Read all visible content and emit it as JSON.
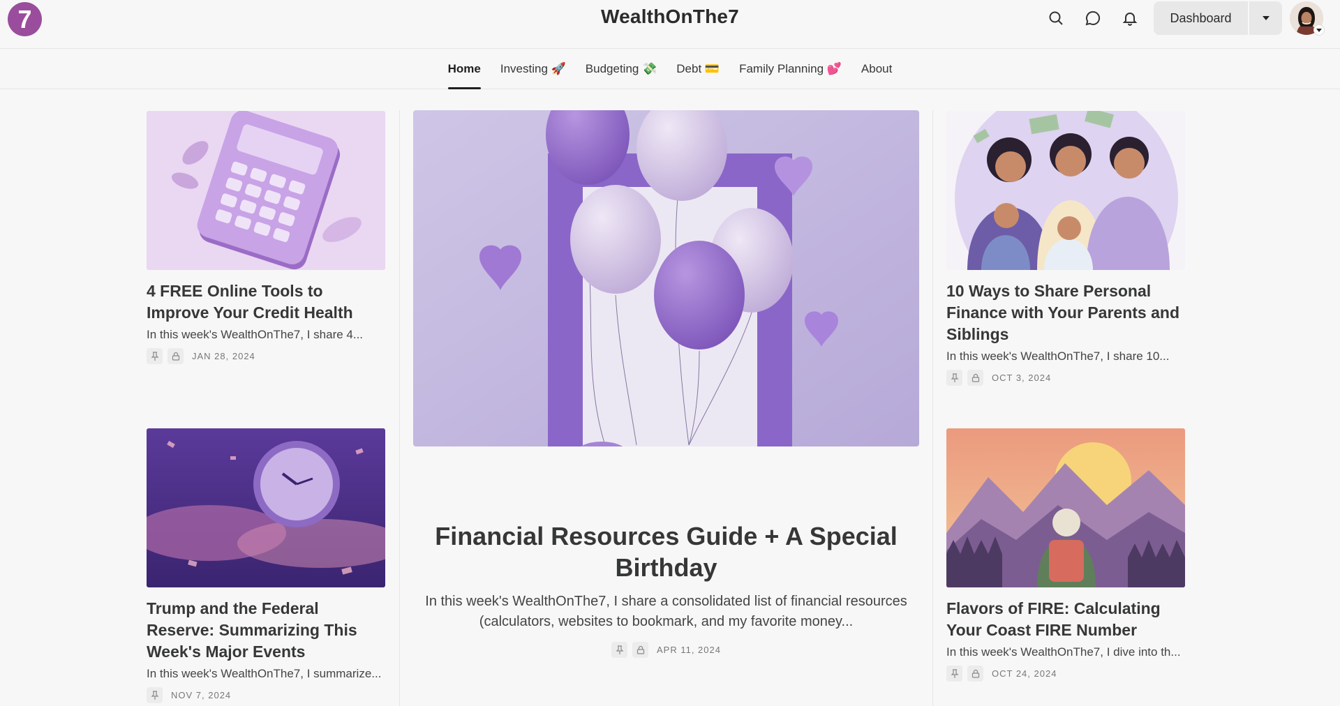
{
  "header": {
    "logo_text": "7",
    "site_title": "WealthOnThe7",
    "dashboard_label": "Dashboard",
    "icons": [
      "search-icon",
      "chat-icon",
      "bell-icon",
      "caret-down-icon"
    ]
  },
  "nav": {
    "items": [
      {
        "label": "Home"
      },
      {
        "label": "Investing 🚀"
      },
      {
        "label": "Budgeting 💸"
      },
      {
        "label": "Debt 💳"
      },
      {
        "label": "Family Planning 💕"
      },
      {
        "label": "About"
      }
    ],
    "active": "Home"
  },
  "posts": {
    "left_top": {
      "title": "4 FREE Online Tools to Improve Your Credit Health",
      "subtitle": "In this week's WealthOnThe7, I share 4...",
      "date": "JAN 28, 2024"
    },
    "left_bottom": {
      "title": "Trump and the Federal Reserve: Summarizing This Week's Major Events",
      "subtitle": "In this week's WealthOnThe7, I summarize...",
      "date": "NOV 7, 2024"
    },
    "feature": {
      "title": "Financial Resources Guide + A Special Birthday",
      "subtitle": "In this week's WealthOnThe7, I share a consolidated list of financial resources (calculators, websites to bookmark, and my favorite money...",
      "date": "APR 11, 2024"
    },
    "right_top": {
      "title": "10 Ways to Share Personal Finance with Your Parents and Siblings",
      "subtitle": "In this week's WealthOnThe7, I share 10...",
      "date": "OCT 3, 2024"
    },
    "right_bottom": {
      "title": "Flavors of FIRE: Calculating Your Coast FIRE Number",
      "subtitle": "In this week's WealthOnThe7, I dive into th...",
      "date": "OCT 24, 2024"
    }
  },
  "colors": {
    "brand": "#9b4d9d",
    "accent_purple": "#8e6cc4",
    "text": "#363737"
  }
}
